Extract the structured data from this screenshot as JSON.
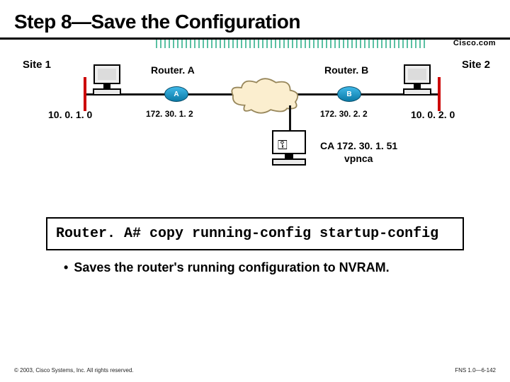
{
  "title": "Step 8—Save the Configuration",
  "brand": "Cisco.com",
  "site1_label": "Site 1",
  "site2_label": "Site 2",
  "routerA_label": "Router. A",
  "routerB_label": "Router. B",
  "routerA_letter": "A",
  "routerB_letter": "B",
  "internet_label": "Internet",
  "site1_net": "10. 0. 1. 0",
  "site2_net": "10. 0. 2. 0",
  "routerA_ip": "172. 30. 1. 2",
  "routerB_ip": "172. 30. 2. 2",
  "ca_line1": "CA 172. 30. 1. 51",
  "ca_line2": "vpnca",
  "cmd_prompt": "Router. A# ",
  "cmd_text": "copy running-config startup-config",
  "bullet_text": "Saves the router's running configuration to NVRAM.",
  "copyright": "© 2003, Cisco Systems, Inc. All rights reserved.",
  "slide_id": "FNS 1.0—6-142"
}
